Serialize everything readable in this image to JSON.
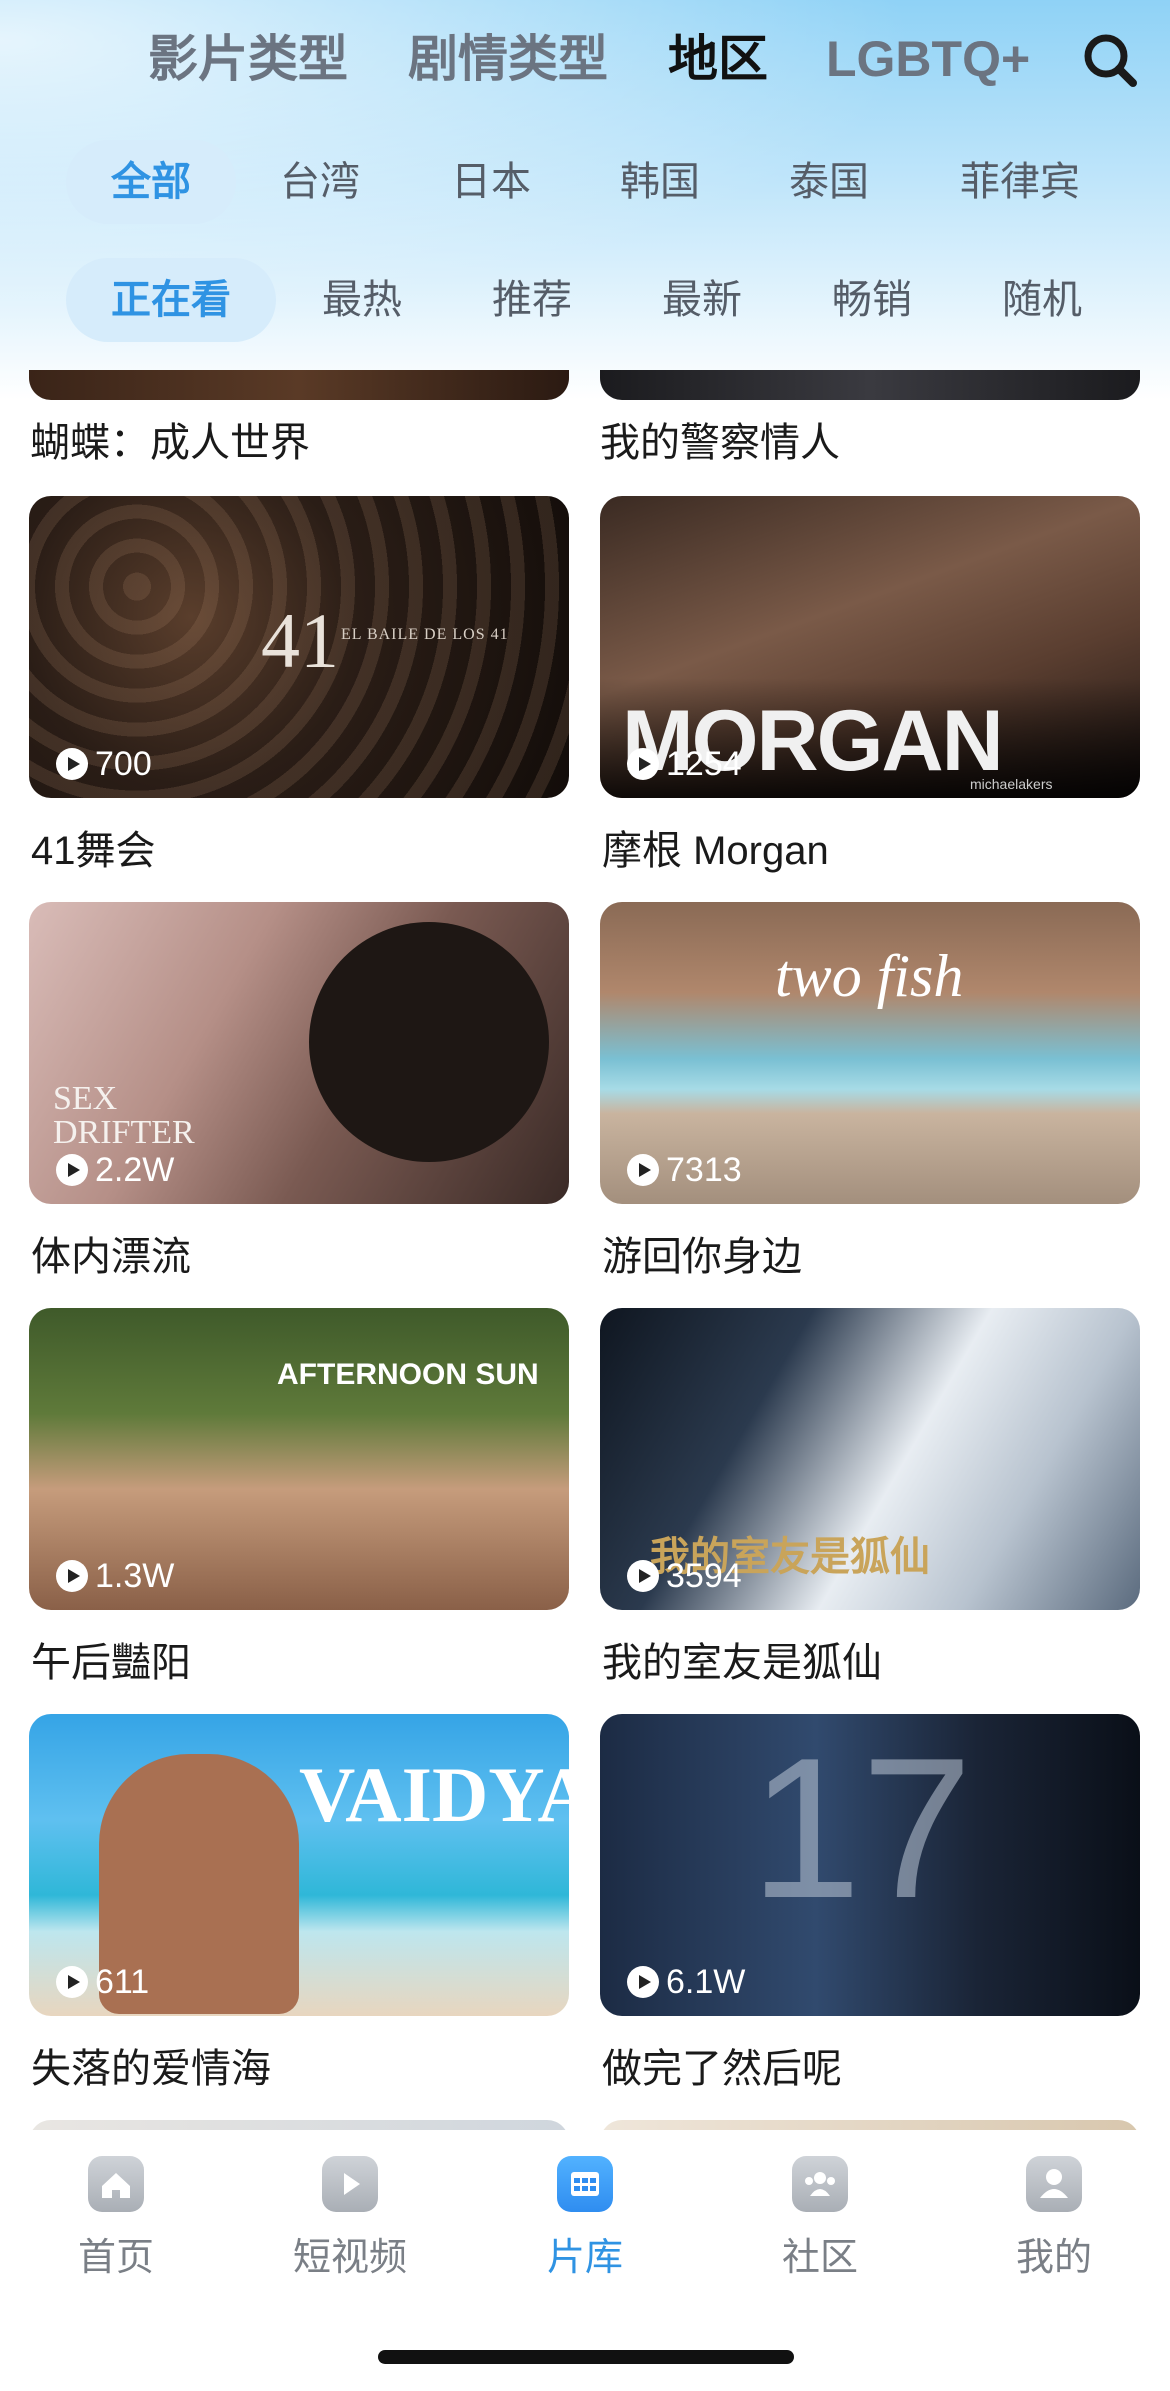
{
  "header": {
    "main_tabs": [
      {
        "label": "影片类型",
        "active": false
      },
      {
        "label": "剧情类型",
        "active": false
      },
      {
        "label": "地区",
        "active": true
      },
      {
        "label": "LGBTQ+",
        "active": false
      }
    ],
    "search_icon": "search-icon"
  },
  "region_filters": [
    {
      "label": "全部",
      "active": true
    },
    {
      "label": "台湾",
      "active": false
    },
    {
      "label": "日本",
      "active": false
    },
    {
      "label": "韩国",
      "active": false
    },
    {
      "label": "泰国",
      "active": false
    },
    {
      "label": "菲律宾",
      "active": false
    }
  ],
  "sort_filters": [
    {
      "label": "正在看",
      "active": true
    },
    {
      "label": "最热",
      "active": false
    },
    {
      "label": "推荐",
      "active": false
    },
    {
      "label": "最新",
      "active": false
    },
    {
      "label": "畅销",
      "active": false
    },
    {
      "label": "随机",
      "active": false
    }
  ],
  "partial_row_top": {
    "titles": [
      "蝴蝶：成人世界",
      "我的警察情人"
    ]
  },
  "movies": [
    {
      "title": "41舞会",
      "plays": "700",
      "poster_text": "41",
      "poster_subtext": "EL BAILE DE LOS 41"
    },
    {
      "title": "摩根 Morgan",
      "plays": "1254",
      "poster_text": "MORGAN",
      "poster_subtext": "michaelakers"
    },
    {
      "title": "体内漂流",
      "plays": "2.2W",
      "poster_text": "SEX",
      "poster_subtext": "DRIFTER"
    },
    {
      "title": "游回你身边",
      "plays": "7313",
      "poster_text": "two fish",
      "poster_subtext": ""
    },
    {
      "title": "午后豔阳",
      "plays": "1.3W",
      "poster_text": "AFTERNOON SUN",
      "poster_subtext": ""
    },
    {
      "title": "我的室友是狐仙",
      "plays": "3594",
      "poster_text": "我的室友是狐仙",
      "poster_subtext": ""
    },
    {
      "title": "失落的爱情海",
      "plays": "611",
      "poster_text": "VAIDYA",
      "poster_subtext": ""
    },
    {
      "title": "做完了然后呢",
      "plays": "6.1W",
      "poster_text": "17",
      "poster_subtext": ""
    }
  ],
  "bottom_nav": [
    {
      "label": "首页",
      "icon": "home-icon",
      "active": false
    },
    {
      "label": "短视频",
      "icon": "play-video-icon",
      "active": false
    },
    {
      "label": "片库",
      "icon": "library-grid-icon",
      "active": true
    },
    {
      "label": "社区",
      "icon": "community-icon",
      "active": false
    },
    {
      "label": "我的",
      "icon": "profile-icon",
      "active": false
    }
  ],
  "colors": {
    "accent": "#2f93e3",
    "active_chip_bg": "#d6ecfb",
    "header_gradient_top": "#8fd2f6"
  }
}
